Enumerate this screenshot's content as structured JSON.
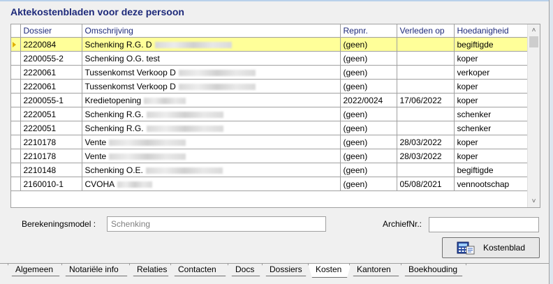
{
  "panel": {
    "title": "Aktekostenbladen voor deze persoon"
  },
  "grid": {
    "columns": [
      "Dossier",
      "Omschrijving",
      "Repnr.",
      "Verleden op",
      "Hoedanigheid"
    ],
    "rows": [
      {
        "dossier": "2220084",
        "omschrijving": "Schenking R.G. D",
        "repnr": "(geen)",
        "verleden_op": "",
        "hoedanigheid": "begiftigde",
        "selected": true
      },
      {
        "dossier": "2200055-2",
        "omschrijving": "Schenking O.G.  test",
        "repnr": "(geen)",
        "verleden_op": "",
        "hoedanigheid": "koper",
        "selected": false
      },
      {
        "dossier": "2220061",
        "omschrijving": "Tussenkomst Verkoop D",
        "repnr": "(geen)",
        "verleden_op": "",
        "hoedanigheid": "verkoper",
        "selected": false
      },
      {
        "dossier": "2220061",
        "omschrijving": "Tussenkomst Verkoop D",
        "repnr": "(geen)",
        "verleden_op": "",
        "hoedanigheid": "koper",
        "selected": false
      },
      {
        "dossier": "2200055-1",
        "omschrijving": "Kredietopening",
        "repnr": "2022/0024",
        "verleden_op": "17/06/2022",
        "hoedanigheid": "koper",
        "selected": false
      },
      {
        "dossier": "2220051",
        "omschrijving": "Schenking R.G.",
        "repnr": "(geen)",
        "verleden_op": "",
        "hoedanigheid": "schenker",
        "selected": false
      },
      {
        "dossier": "2220051",
        "omschrijving": "Schenking R.G.",
        "repnr": "(geen)",
        "verleden_op": "",
        "hoedanigheid": "schenker",
        "selected": false
      },
      {
        "dossier": "2210178",
        "omschrijving": "Vente",
        "repnr": "(geen)",
        "verleden_op": "28/03/2022",
        "hoedanigheid": "koper",
        "selected": false
      },
      {
        "dossier": "2210178",
        "omschrijving": "Vente",
        "repnr": "(geen)",
        "verleden_op": "28/03/2022",
        "hoedanigheid": "koper",
        "selected": false
      },
      {
        "dossier": "2210148",
        "omschrijving": "Schenking O.E.",
        "repnr": "(geen)",
        "verleden_op": "",
        "hoedanigheid": "begiftigde",
        "selected": false
      },
      {
        "dossier": "2160010-1",
        "omschrijving": "CVOHA",
        "repnr": "(geen)",
        "verleden_op": "05/08/2021",
        "hoedanigheid": "vennootschap",
        "selected": false
      }
    ]
  },
  "form": {
    "berekeningsmodel_label": "Berekeningsmodel :",
    "berekeningsmodel_value": "Schenking",
    "archiefnr_label": "ArchiefNr.:",
    "archiefnr_value": ""
  },
  "button": {
    "kostenblad_label": "Kostenblad",
    "icon": "calculator-icon"
  },
  "tabs": [
    {
      "label": "Algemeen",
      "active": false
    },
    {
      "label": "Notariële info",
      "active": false
    },
    {
      "label": "Relaties",
      "active": false
    },
    {
      "label": "Contacten",
      "active": false
    },
    {
      "label": "Docs",
      "active": false
    },
    {
      "label": "Dossiers",
      "active": false
    },
    {
      "label": "Kosten",
      "active": true
    },
    {
      "label": "Kantoren",
      "active": false
    },
    {
      "label": "Boekhouding",
      "active": false
    }
  ],
  "colors": {
    "title": "#1e2a7a",
    "selected_row": "#ffff99",
    "indicator": "#e0b000"
  }
}
